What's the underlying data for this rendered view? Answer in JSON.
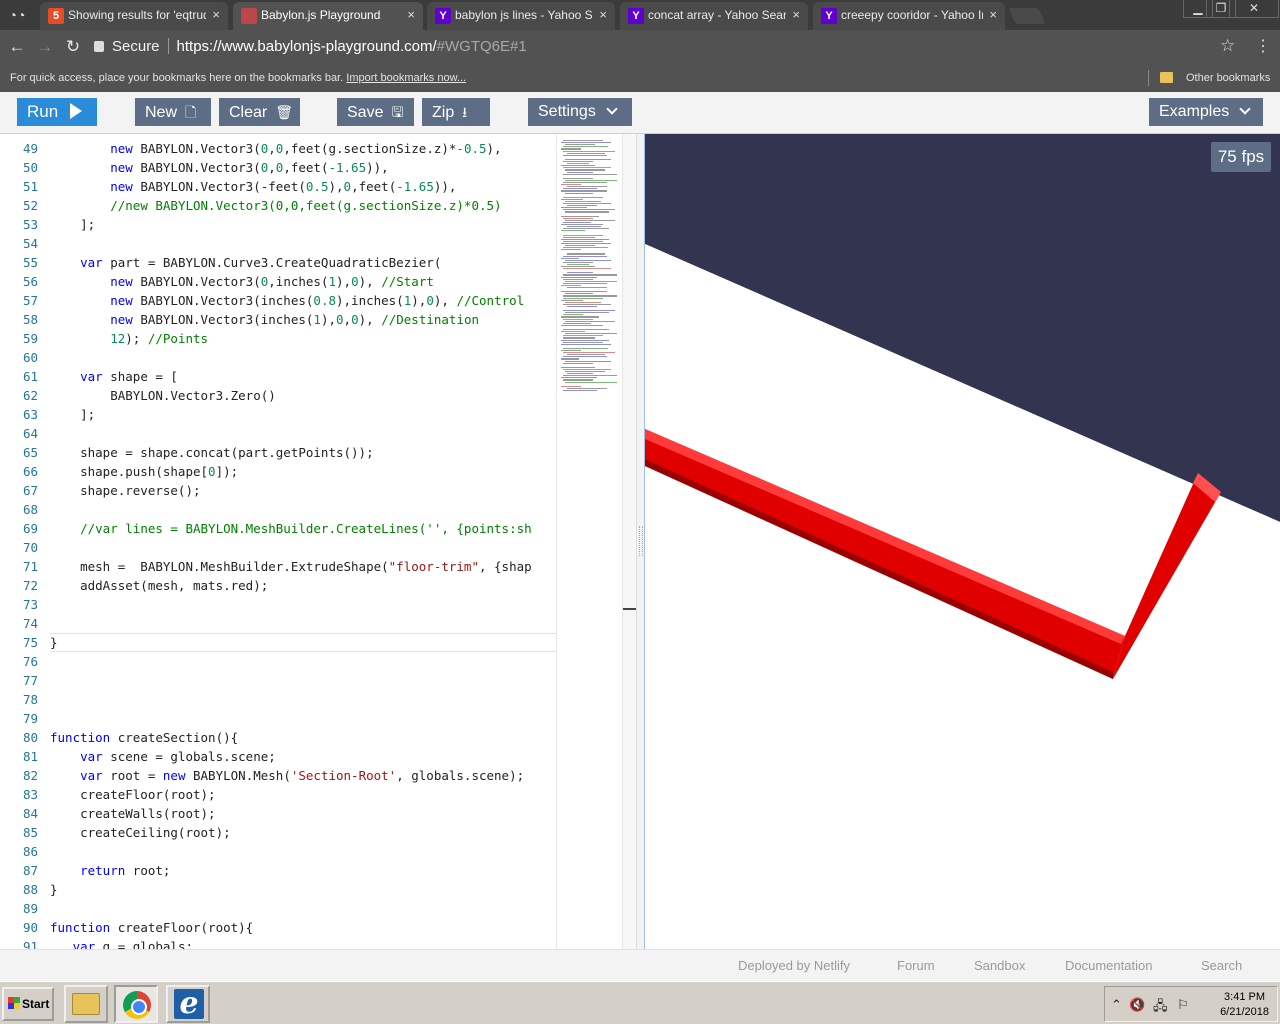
{
  "browser": {
    "tabs": [
      {
        "title": "Showing results for 'eqtrude'",
        "icon": "html5-icon",
        "icon_color": "#e44d26",
        "active": false
      },
      {
        "title": "Babylon.js Playground",
        "icon": "babylonjs-icon",
        "icon_color": "#bb464b",
        "active": true
      },
      {
        "title": "babylon js lines - Yahoo Search",
        "icon": "yahoo-icon",
        "icon_color": "#5f01d1",
        "active": false
      },
      {
        "title": "concat array - Yahoo Search",
        "icon": "yahoo-icon",
        "icon_color": "#5f01d1",
        "active": false
      },
      {
        "title": "creeepy cooridor - Yahoo Images",
        "icon": "yahoo-icon",
        "icon_color": "#5f01d1",
        "active": false
      }
    ],
    "tab_close_glyph": "×",
    "yahoo_glyph": "Y",
    "html5_glyph": "5",
    "address": {
      "secure_label": "Secure",
      "url_host": "https://www.babylonjs-playground.com/",
      "url_path": "#WGTQ6E#1"
    },
    "bookmarks_bar": {
      "hint": "For quick access, place your bookmarks here on the bookmarks bar.",
      "import_link": "Import bookmarks now...",
      "other_bookmarks": "Other bookmarks"
    }
  },
  "playground": {
    "toolbar": {
      "run": "Run",
      "new": "New",
      "clear": "Clear",
      "save": "Save",
      "zip": "Zip",
      "settings": "Settings",
      "examples": "Examples"
    },
    "fps": "75 fps",
    "footer": {
      "deployed": "Deployed by Netlify",
      "forum": "Forum",
      "sandbox": "Sandbox",
      "documentation": "Documentation",
      "search": "Search"
    },
    "colors": {
      "button": "#5d6d86",
      "run_button": "#2a8bd9",
      "canvas_background": "#333550",
      "mesh": "#ff0000"
    }
  },
  "editor": {
    "lines": [
      {
        "n": "49",
        "code": "        new BABYLON.Vector3(0,0,feet(g.sectionSize.z)*-0.5),"
      },
      {
        "n": "50",
        "code": "        new BABYLON.Vector3(0,0,feet(-1.65)),"
      },
      {
        "n": "51",
        "code": "        new BABYLON.Vector3(-feet(0.5),0,feet(-1.65)),"
      },
      {
        "n": "52",
        "code": "        //new BABYLON.Vector3(0,0,feet(g.sectionSize.z)*0.5)"
      },
      {
        "n": "53",
        "code": "    ];"
      },
      {
        "n": "54",
        "code": ""
      },
      {
        "n": "55",
        "code": "    var part = BABYLON.Curve3.CreateQuadraticBezier("
      },
      {
        "n": "56",
        "code": "        new BABYLON.Vector3(0,inches(1),0), //Start"
      },
      {
        "n": "57",
        "code": "        new BABYLON.Vector3(inches(0.8),inches(1),0), //Control"
      },
      {
        "n": "58",
        "code": "        new BABYLON.Vector3(inches(1),0,0), //Destination"
      },
      {
        "n": "59",
        "code": "        12); //Points"
      },
      {
        "n": "60",
        "code": ""
      },
      {
        "n": "61",
        "code": "    var shape = ["
      },
      {
        "n": "62",
        "code": "        BABYLON.Vector3.Zero()"
      },
      {
        "n": "63",
        "code": "    ];"
      },
      {
        "n": "64",
        "code": ""
      },
      {
        "n": "65",
        "code": "    shape = shape.concat(part.getPoints());"
      },
      {
        "n": "66",
        "code": "    shape.push(shape[0]);"
      },
      {
        "n": "67",
        "code": "    shape.reverse();"
      },
      {
        "n": "68",
        "code": ""
      },
      {
        "n": "69",
        "code": "    //var lines = BABYLON.MeshBuilder.CreateLines('', {points:sh"
      },
      {
        "n": "70",
        "code": ""
      },
      {
        "n": "71",
        "code": "    mesh =  BABYLON.MeshBuilder.ExtrudeShape(\"floor-trim\", {shap"
      },
      {
        "n": "72",
        "code": "    addAsset(mesh, mats.red);"
      },
      {
        "n": "73",
        "code": ""
      },
      {
        "n": "74",
        "code": ""
      },
      {
        "n": "75",
        "code": "}"
      },
      {
        "n": "76",
        "code": ""
      },
      {
        "n": "77",
        "code": ""
      },
      {
        "n": "78",
        "code": ""
      },
      {
        "n": "79",
        "code": ""
      },
      {
        "n": "80",
        "code": "function createSection(){"
      },
      {
        "n": "81",
        "code": "    var scene = globals.scene;"
      },
      {
        "n": "82",
        "code": "    var root = new BABYLON.Mesh('Section-Root', globals.scene);"
      },
      {
        "n": "83",
        "code": "    createFloor(root);"
      },
      {
        "n": "84",
        "code": "    createWalls(root);"
      },
      {
        "n": "85",
        "code": "    createCeiling(root);"
      },
      {
        "n": "86",
        "code": ""
      },
      {
        "n": "87",
        "code": "    return root;"
      },
      {
        "n": "88",
        "code": "}"
      },
      {
        "n": "89",
        "code": ""
      },
      {
        "n": "90",
        "code": "function createFloor(root){"
      },
      {
        "n": "91",
        "code": "   var g = globals;"
      }
    ]
  },
  "taskbar": {
    "start": "Start",
    "clock_time": "3:41 PM",
    "clock_date": "6/21/2018"
  }
}
